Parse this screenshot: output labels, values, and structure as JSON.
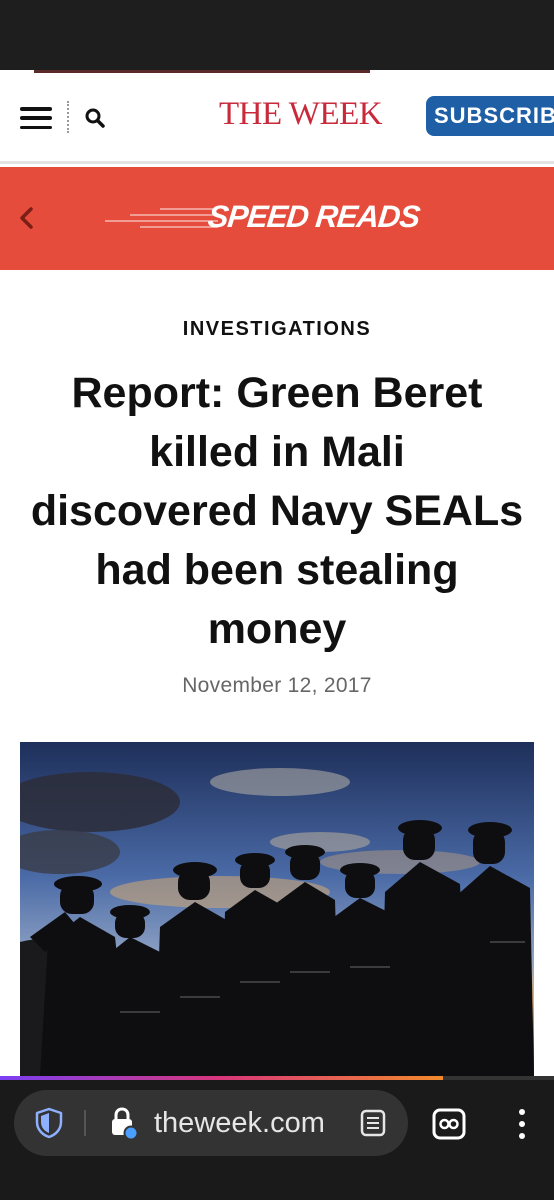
{
  "header": {
    "logo_text": "THE WEEK",
    "subscribe_label": "SUBSCRIBE",
    "menu_icon": "hamburger-menu-icon",
    "search_icon": "search-icon"
  },
  "speed_reads": {
    "title": "SPEED READS",
    "back_icon": "chevron-left-icon"
  },
  "article": {
    "category": "INVESTIGATIONS",
    "headline": "Report: Green Beret killed in Mali discovered Navy SEALs had been stealing money",
    "date": "November 12, 2017",
    "image_icon": "soldiers-silhouette-photo"
  },
  "browser": {
    "url": "theweek.com",
    "scroll_progress": 0.8,
    "icons": [
      "shield-icon",
      "lock-icon",
      "reader-mode-icon",
      "tabs-icon",
      "more-options-icon"
    ]
  },
  "colors": {
    "brand_red": "#c8293b",
    "speed_reads_bg": "#e64c3c",
    "subscribe_bg": "#1f5fa6"
  }
}
